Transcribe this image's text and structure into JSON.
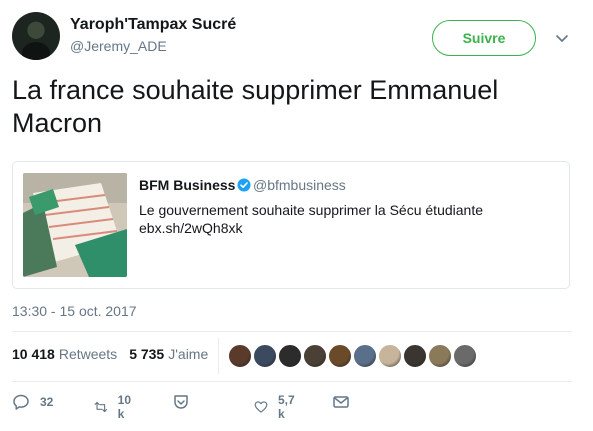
{
  "author": {
    "name": "Yaroph'Tampax Sucré",
    "handle": "@Jeremy_ADE"
  },
  "follow": {
    "label": "Suivre"
  },
  "tweet": {
    "text": "La france souhaite supprimer Emmanuel Macron",
    "timestamp": "13:30 - 15 oct. 2017"
  },
  "quoted": {
    "name": "BFM Business",
    "handle": "@bfmbusiness",
    "text": "Le gouvernement souhaite supprimer la Sécu étudiante",
    "link": "ebx.sh/2wQh8xk"
  },
  "stats": {
    "retweets_count": "10 418",
    "retweets_label": "Retweets",
    "likes_count": "5 735",
    "likes_label": "J'aime"
  },
  "likers": [
    "#5a3a2a",
    "#3b4a5e",
    "#2c2c2c",
    "#4a4036",
    "#6b4a2a",
    "#5a6f8a",
    "#c6b59a",
    "#3a3530",
    "#8a7a5a",
    "#6a6a6a"
  ],
  "actions": {
    "reply_count": "32",
    "retweet_count": "10 k",
    "like_count": "5,7 k"
  },
  "colors": {
    "follow_green": "#3bb24d",
    "verified_blue": "#1da1f2",
    "muted": "#657786"
  },
  "icons": [
    "caret-down-icon",
    "verified-badge-icon",
    "reply-icon",
    "retweet-icon",
    "save-icon",
    "like-icon",
    "message-icon"
  ]
}
